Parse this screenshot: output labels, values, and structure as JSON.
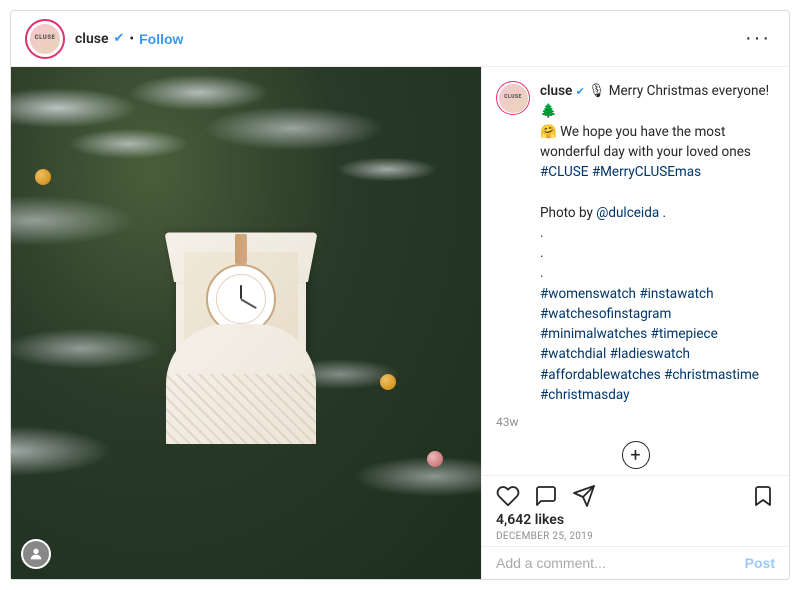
{
  "header": {
    "username": "cluse",
    "verified": true,
    "follow_label": "Follow",
    "more_label": "···"
  },
  "caption": {
    "username": "cluse",
    "verified": true,
    "text_parts": [
      "🎙 Merry Christmas everyone! 🌲",
      "🤗 We hope you have the most wonderful day with your loved ones",
      "#CLUSE #MerryCLUSEmas",
      "",
      "Photo by @dulceida .",
      ".",
      ".",
      ".",
      "#womenswatch #instawatch #watchesofinstagram #minimalwatches #timepiece #watchdial #ladieswatch #affordablewatches #christmastime #christmasday"
    ],
    "timestamp": "43w"
  },
  "actions": {
    "like_label": "Like",
    "comment_label": "Comment",
    "share_label": "Share",
    "bookmark_label": "Bookmark"
  },
  "stats": {
    "likes": "4,642 likes",
    "date": "December 25, 2019"
  },
  "comment_input": {
    "placeholder": "Add a comment...",
    "post_label": "Post"
  }
}
